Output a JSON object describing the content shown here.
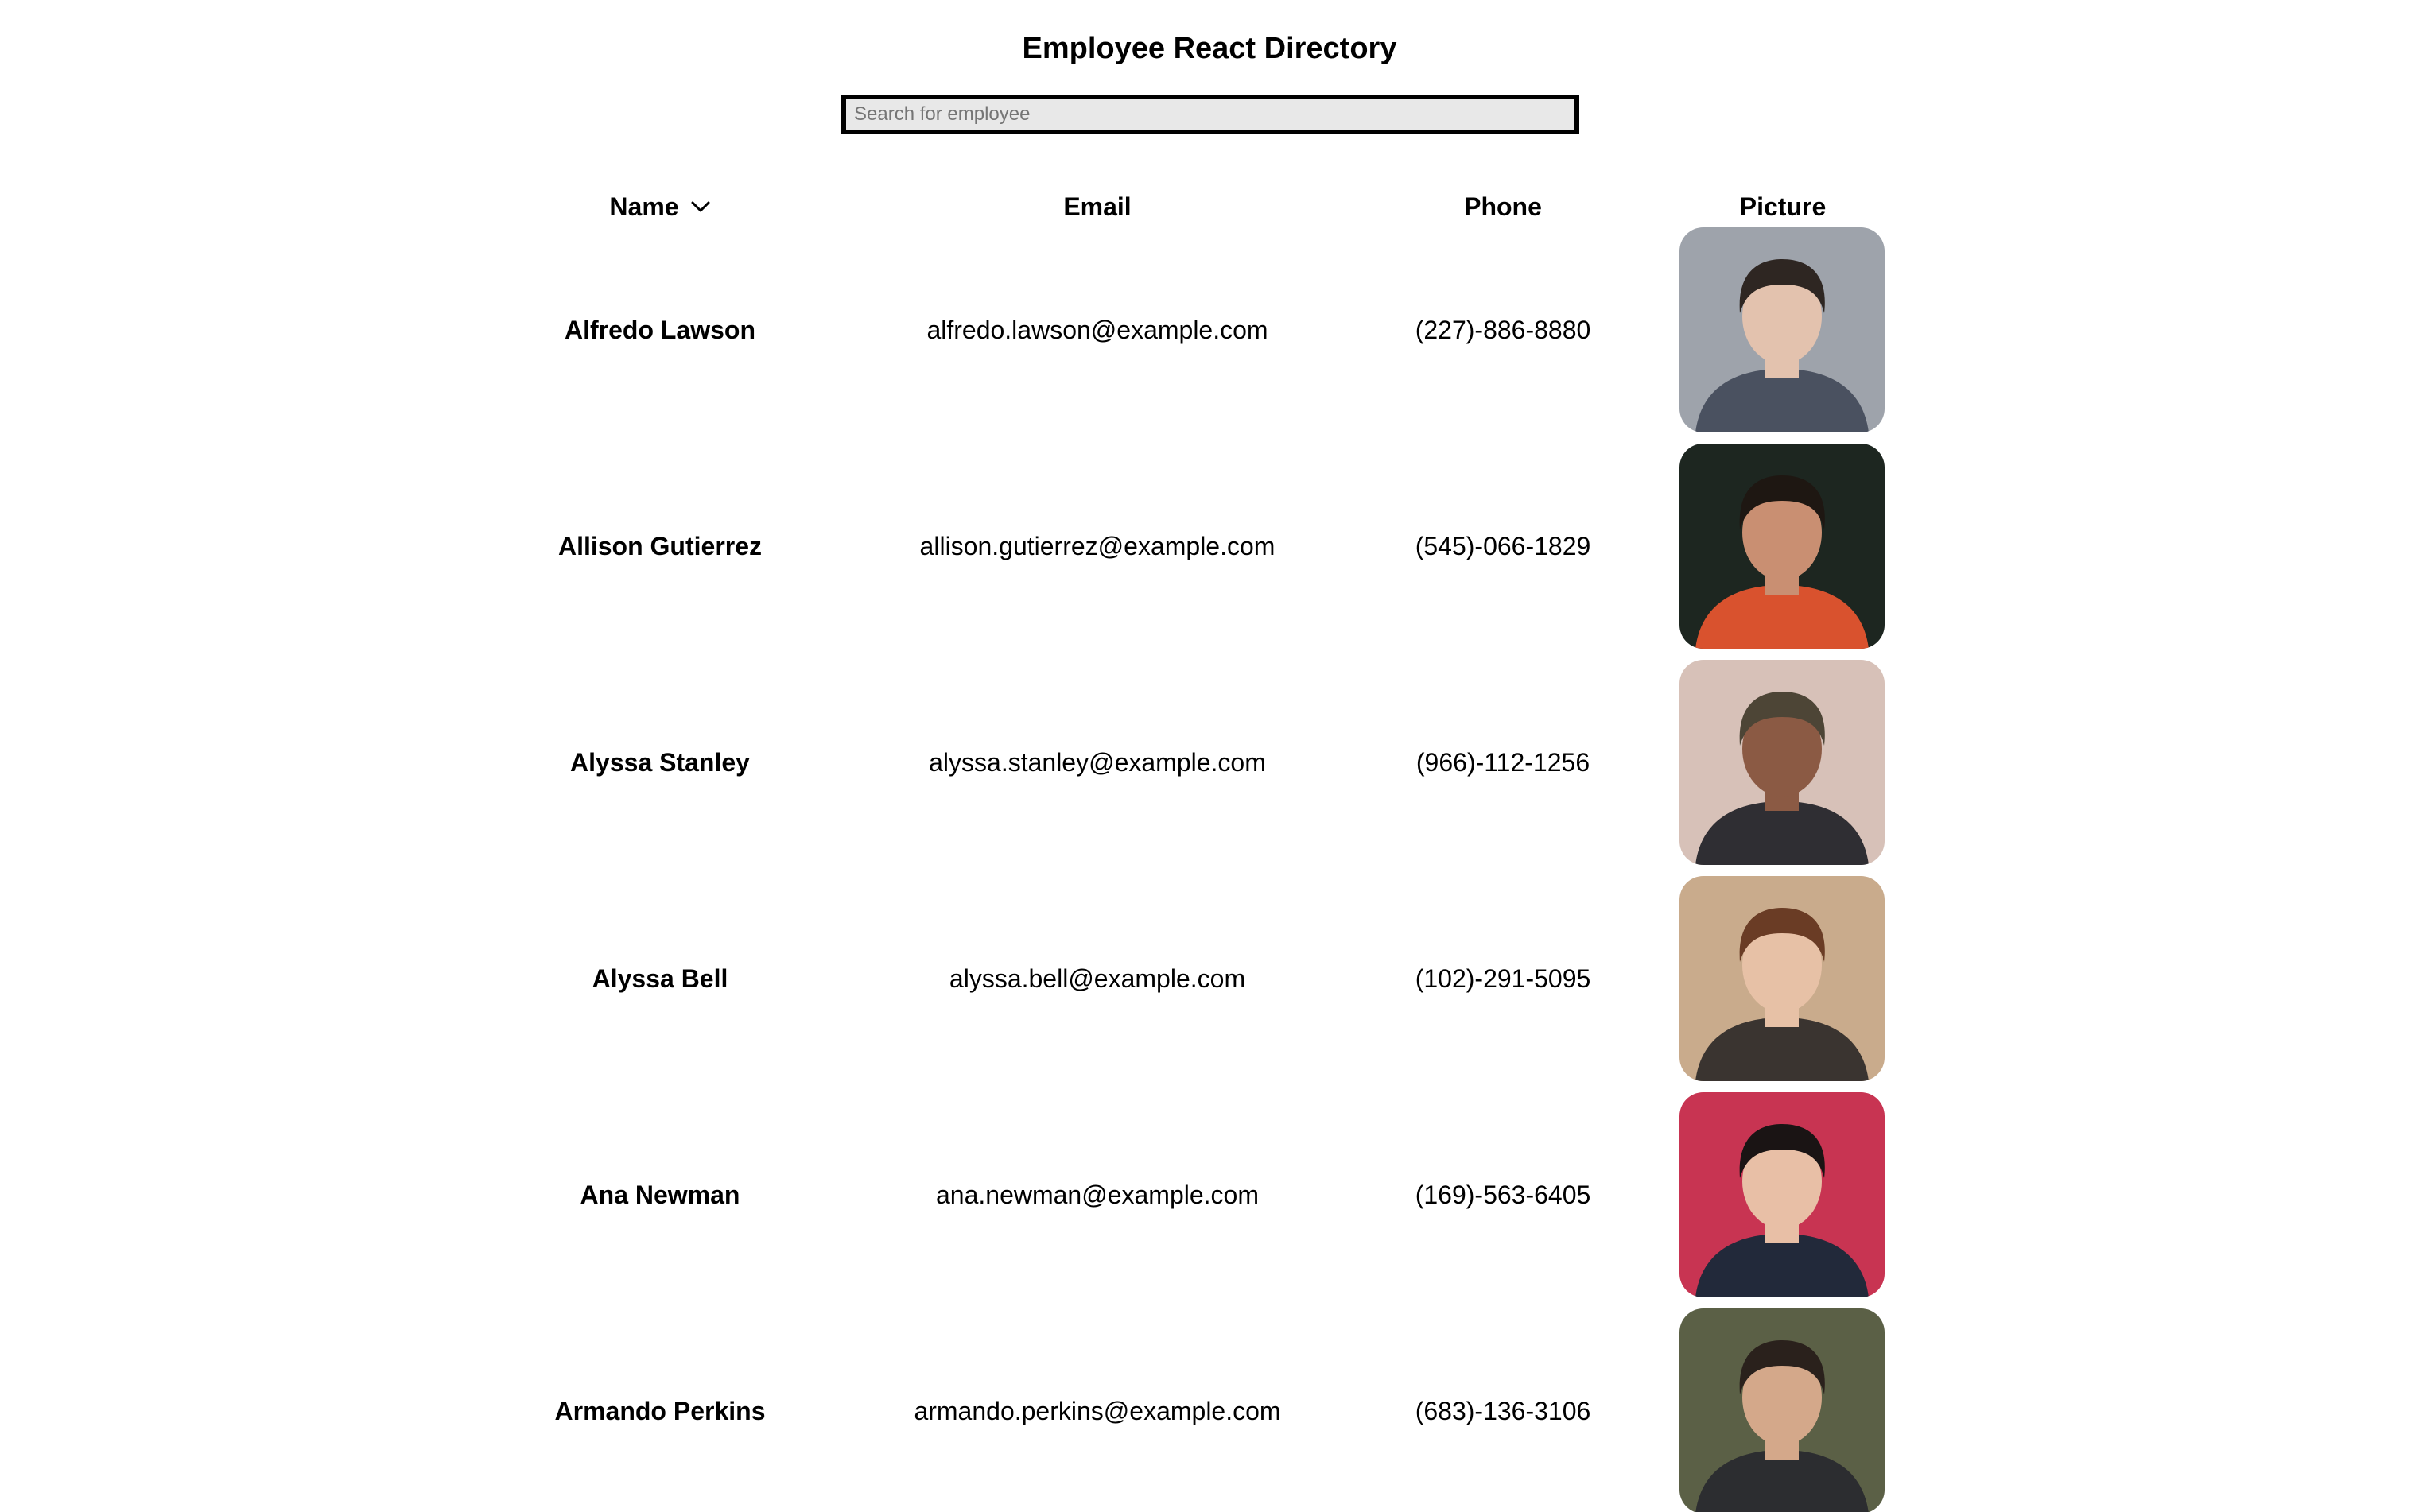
{
  "app": {
    "title": "Employee React Directory"
  },
  "search": {
    "placeholder": "Search for employee",
    "value": ""
  },
  "table": {
    "headers": {
      "name": "Name",
      "email": "Email",
      "phone": "Phone",
      "picture": "Picture"
    },
    "sort": {
      "column": "name",
      "direction": "ascending"
    },
    "rows": [
      {
        "name": "Alfredo Lawson",
        "email": "alfredo.lawson@example.com",
        "phone": "(227)-886-8880",
        "photo": {
          "bg": "#9ea3ab",
          "skin": "#e3c2ae",
          "hair": "#2e2622",
          "clothes": "#4a5160"
        }
      },
      {
        "name": "Allison Gutierrez",
        "email": "allison.gutierrez@example.com",
        "phone": "(545)-066-1829",
        "photo": {
          "bg": "#1d2620",
          "skin": "#c98f72",
          "hair": "#1e1712",
          "clothes": "#d9522e"
        }
      },
      {
        "name": "Alyssa Stanley",
        "email": "alyssa.stanley@example.com",
        "phone": "(966)-112-1256",
        "photo": {
          "bg": "#d7c1b8",
          "skin": "#8b5a44",
          "hair": "#4d4536",
          "clothes": "#2f2e33"
        }
      },
      {
        "name": "Alyssa Bell",
        "email": "alyssa.bell@example.com",
        "phone": "(102)-291-5095",
        "photo": {
          "bg": "#c9ab8c",
          "skin": "#e7c1a6",
          "hair": "#6a3c25",
          "clothes": "#3a3430"
        }
      },
      {
        "name": "Ana Newman",
        "email": "ana.newman@example.com",
        "phone": "(169)-563-6405",
        "photo": {
          "bg": "#c83452",
          "skin": "#e8bfa6",
          "hair": "#1a1414",
          "clothes": "#22293a"
        }
      },
      {
        "name": "Armando Perkins",
        "email": "armando.perkins@example.com",
        "phone": "(683)-136-3106",
        "photo": {
          "bg": "#5b6046",
          "skin": "#d4a88a",
          "hair": "#2a211c",
          "clothes": "#2c2d30"
        }
      }
    ]
  }
}
